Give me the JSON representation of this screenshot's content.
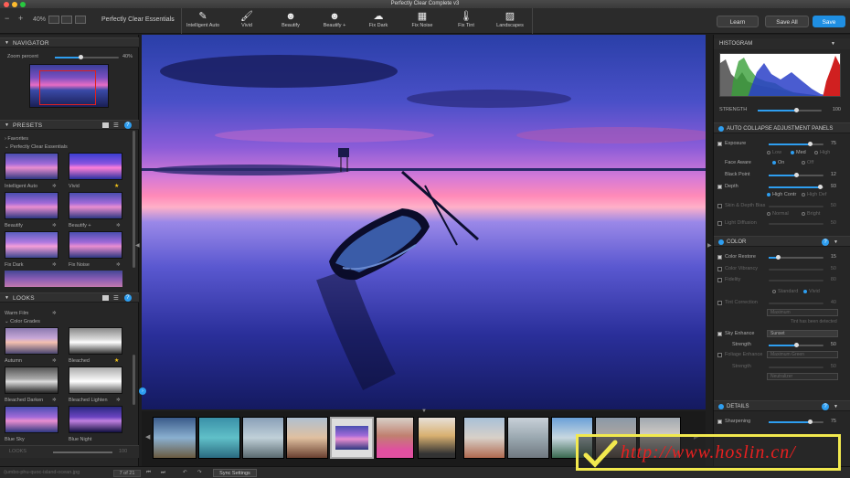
{
  "app": {
    "title": "Perfectly Clear Complete v3"
  },
  "toolbar": {
    "zoom": "40%",
    "preset_dropdown": "Perfectly Clear Essentials",
    "tools": [
      {
        "label": "Intelligent Auto",
        "icon": "wand-icon"
      },
      {
        "label": "Vivid",
        "icon": "brush-icon"
      },
      {
        "label": "Beautify",
        "icon": "face-icon"
      },
      {
        "label": "Beautify +",
        "icon": "face-plus-icon"
      },
      {
        "label": "Fix Dark",
        "icon": "cloud-icon"
      },
      {
        "label": "Fix Noise",
        "icon": "noise-icon"
      },
      {
        "label": "Fix Tint",
        "icon": "thermometer-icon"
      },
      {
        "label": "Landscapes",
        "icon": "landscape-icon"
      }
    ],
    "learn": "Learn",
    "save_all": "Save All",
    "save": "Save"
  },
  "navigator": {
    "title": "NAVIGATOR",
    "zoom_label": "Zoom percent",
    "zoom_value": "40%",
    "zoom_level": 0.4
  },
  "presets": {
    "title": "PRESETS",
    "favorites": "Favorites",
    "group": "Perfectly Clear Essentials",
    "items": [
      {
        "label": "Intelligent Auto"
      },
      {
        "label": "Vivid"
      },
      {
        "label": "Beautify"
      },
      {
        "label": "Beautify +"
      },
      {
        "label": "Fix Dark"
      },
      {
        "label": "Fix Noise"
      }
    ]
  },
  "looks": {
    "title": "LOOKS",
    "warm_film": "Warm Film",
    "group": "Color Grades",
    "items": [
      {
        "label": "Autumn"
      },
      {
        "label": "Bleached"
      },
      {
        "label": "Bleached Darken"
      },
      {
        "label": "Bleached Lighten"
      },
      {
        "label": "Blue Sky"
      },
      {
        "label": "Blue Night"
      }
    ],
    "strength_label": "LOOKS",
    "strength_value": "100"
  },
  "right": {
    "histogram": "HISTOGRAM",
    "strength_label": "STRENGTH",
    "strength_value": "100",
    "auto_collapse": "AUTO COLLAPSE ADJUSTMENT PANELS",
    "exposure": {
      "label": "Exposure",
      "value": "75",
      "options": [
        "Low",
        "Med",
        "High"
      ]
    },
    "face_aware": {
      "label": "Face Aware",
      "on": "On",
      "off": "Off"
    },
    "black_point": {
      "label": "Black Point",
      "value": "12"
    },
    "depth": {
      "label": "Depth",
      "value": "93",
      "options": [
        "High Contr",
        "High Def"
      ]
    },
    "skin_depth_bias": {
      "label": "Skin & Depth Bias",
      "value": "50",
      "options": [
        "Normal",
        "Bright"
      ]
    },
    "light_diffusion": {
      "label": "Light Diffusion",
      "value": "50"
    },
    "color": "COLOR",
    "color_restore": {
      "label": "Color Restore",
      "value": "15"
    },
    "color_vibrancy": {
      "label": "Color Vibrancy",
      "value": "50"
    },
    "fidelity": {
      "label": "Fidelity",
      "value": "80",
      "options": [
        "Standard",
        "Vivid"
      ]
    },
    "tint_correction": {
      "label": "Tint Correction",
      "value": "40",
      "dropdown": "Maximum",
      "note": "Tint has been detected"
    },
    "sky_enhance": {
      "label": "Sky Enhance",
      "dropdown": "Sunset"
    },
    "sky_strength": {
      "label": "Strength",
      "value": "50"
    },
    "foliage_enhance": {
      "label": "Foliage Enhance",
      "dropdown": "Maximum Green"
    },
    "foliage_strength": {
      "label": "Strength",
      "value": "50",
      "dropdown": "Neutralizer"
    },
    "details": "DETAILS",
    "sharpening": {
      "label": "Sharpening",
      "value": "75"
    }
  },
  "status": {
    "filename": "/jumbo-phu-quoc-island-ocean.jpg",
    "counter": "7 of 21",
    "sync": "Sync Settings"
  },
  "watermark": {
    "text": "http://www.hoslin.cn/"
  },
  "colors": {
    "accent": "#2e9ef0",
    "save_button": "#1f8fe3",
    "panel": "#262626",
    "star": "#f5c518"
  }
}
